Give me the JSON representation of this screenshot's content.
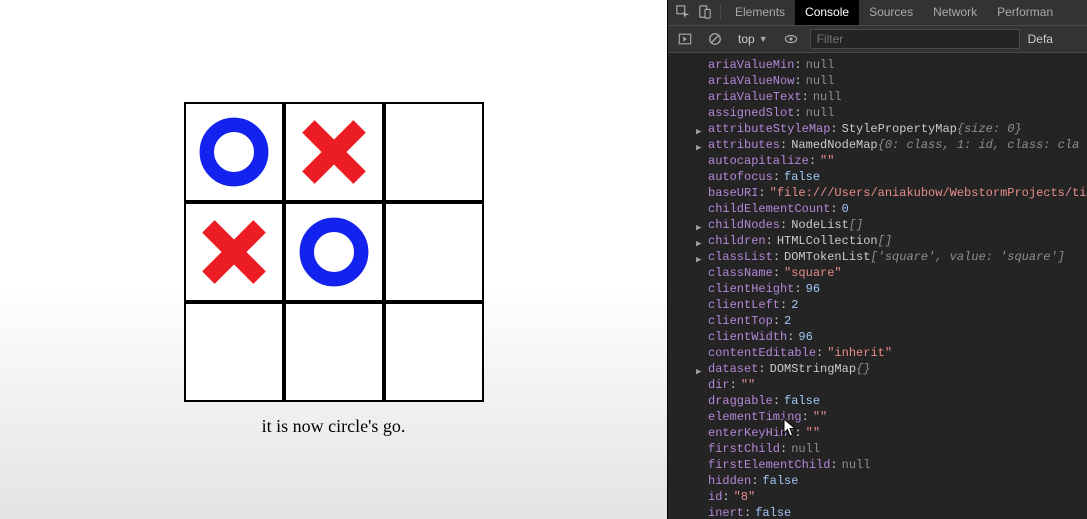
{
  "game": {
    "status_text": "it is now circle's go.",
    "cells": [
      "circle",
      "cross",
      "",
      "cross",
      "circle",
      "",
      "",
      "",
      ""
    ],
    "colors": {
      "circle": "#1422ef",
      "cross": "#ec1c24"
    }
  },
  "devtools": {
    "tabs": [
      "Elements",
      "Console",
      "Sources",
      "Network",
      "Performan"
    ],
    "active_tab": "Console",
    "toolbar": {
      "context": "top",
      "filter_placeholder": "Filter",
      "levels_label": "Defa"
    },
    "properties": [
      {
        "key": "ariaValueMin",
        "kind": "null",
        "value": "null",
        "expandable": false
      },
      {
        "key": "ariaValueNow",
        "kind": "null",
        "value": "null",
        "expandable": false
      },
      {
        "key": "ariaValueText",
        "kind": "null",
        "value": "null",
        "expandable": false
      },
      {
        "key": "assignedSlot",
        "kind": "null",
        "value": "null",
        "expandable": false
      },
      {
        "key": "attributeStyleMap",
        "kind": "obj",
        "type": "StylePropertyMap",
        "inner": "{size: 0}",
        "expandable": true
      },
      {
        "key": "attributes",
        "kind": "obj",
        "type": "NamedNodeMap",
        "inner": "{0: class, 1: id, class: cla",
        "expandable": true
      },
      {
        "key": "autocapitalize",
        "kind": "str",
        "value": "\"\"",
        "expandable": false
      },
      {
        "key": "autofocus",
        "kind": "bool",
        "value": "false",
        "expandable": false
      },
      {
        "key": "baseURI",
        "kind": "link",
        "value": "\"file:///Users/aniakubow/WebstormProjects/ti",
        "expandable": false
      },
      {
        "key": "childElementCount",
        "kind": "num",
        "value": "0",
        "expandable": false
      },
      {
        "key": "childNodes",
        "kind": "obj",
        "type": "NodeList",
        "inner": "[]",
        "expandable": true
      },
      {
        "key": "children",
        "kind": "obj",
        "type": "HTMLCollection",
        "inner": "[]",
        "expandable": true
      },
      {
        "key": "classList",
        "kind": "obj",
        "type": "DOMTokenList",
        "inner": "['square', value: 'square']",
        "expandable": true
      },
      {
        "key": "className",
        "kind": "str",
        "value": "\"square\"",
        "expandable": false
      },
      {
        "key": "clientHeight",
        "kind": "num",
        "value": "96",
        "expandable": false
      },
      {
        "key": "clientLeft",
        "kind": "num",
        "value": "2",
        "expandable": false
      },
      {
        "key": "clientTop",
        "kind": "num",
        "value": "2",
        "expandable": false
      },
      {
        "key": "clientWidth",
        "kind": "num",
        "value": "96",
        "expandable": false
      },
      {
        "key": "contentEditable",
        "kind": "str",
        "value": "\"inherit\"",
        "expandable": false
      },
      {
        "key": "dataset",
        "kind": "obj",
        "type": "DOMStringMap",
        "inner": "{}",
        "expandable": true
      },
      {
        "key": "dir",
        "kind": "str",
        "value": "\"\"",
        "expandable": false
      },
      {
        "key": "draggable",
        "kind": "bool",
        "value": "false",
        "expandable": false
      },
      {
        "key": "elementTiming",
        "kind": "str",
        "value": "\"\"",
        "expandable": false
      },
      {
        "key": "enterKeyHint",
        "kind": "str",
        "value": "\"\"",
        "expandable": false
      },
      {
        "key": "firstChild",
        "kind": "null",
        "value": "null",
        "expandable": false
      },
      {
        "key": "firstElementChild",
        "kind": "null",
        "value": "null",
        "expandable": false
      },
      {
        "key": "hidden",
        "kind": "bool",
        "value": "false",
        "expandable": false
      },
      {
        "key": "id",
        "kind": "str",
        "value": "\"8\"",
        "expandable": false
      },
      {
        "key": "inert",
        "kind": "bool",
        "value": "false",
        "expandable": false
      }
    ],
    "icons": {
      "inspect": "inspect-icon",
      "device": "device-toggle-icon",
      "step": "step-icon",
      "clear": "clear-console-icon",
      "eye": "eye-icon"
    }
  }
}
